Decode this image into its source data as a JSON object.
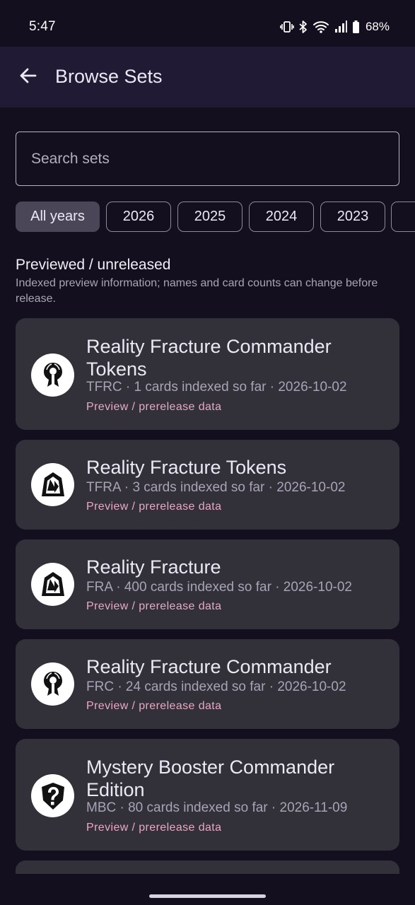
{
  "status_bar": {
    "time": "5:47",
    "battery": "68%",
    "icons": [
      "vibrate-icon",
      "bluetooth-icon",
      "wifi-icon",
      "signal-icon",
      "battery-icon"
    ]
  },
  "app_bar": {
    "title": "Browse Sets",
    "back_icon": "arrow-back-icon"
  },
  "search": {
    "placeholder": "Search sets",
    "value": ""
  },
  "year_filters": {
    "selected": "All years",
    "chips": [
      "All years",
      "2026",
      "2025",
      "2024",
      "2023",
      ""
    ]
  },
  "section": {
    "title": "Previewed / unreleased",
    "subtitle": "Indexed preview information; names and card counts can change before release."
  },
  "sets": [
    {
      "name": "Reality Fracture Commander Tokens",
      "meta": "TFRC · 1 cards indexed so far · 2026-10-02",
      "tag": "Preview / prerelease data",
      "icon": "commander-set-symbol-icon"
    },
    {
      "name": "Reality Fracture Tokens",
      "meta": "TFRA · 3 cards indexed so far · 2026-10-02",
      "tag": "Preview / prerelease data",
      "icon": "reality-fracture-set-symbol-icon"
    },
    {
      "name": "Reality Fracture",
      "meta": "FRA · 400 cards indexed so far · 2026-10-02",
      "tag": "Preview / prerelease data",
      "icon": "reality-fracture-set-symbol-icon"
    },
    {
      "name": "Reality Fracture Commander",
      "meta": "FRC · 24 cards indexed so far · 2026-10-02",
      "tag": "Preview / prerelease data",
      "icon": "commander-set-symbol-icon"
    },
    {
      "name": "Mystery Booster Commander Edition",
      "meta": "MBC · 80 cards indexed so far · 2026-11-09",
      "tag": "Preview / prerelease data",
      "icon": "mystery-booster-set-symbol-icon"
    }
  ],
  "colors": {
    "background": "#130f1e",
    "app_bar": "#211a35",
    "card": "#323039",
    "chip_selected": "#4a4657",
    "accent_pink": "#e8a9c3",
    "text_primary": "#ece8f4",
    "text_secondary": "#a9a3b5"
  }
}
